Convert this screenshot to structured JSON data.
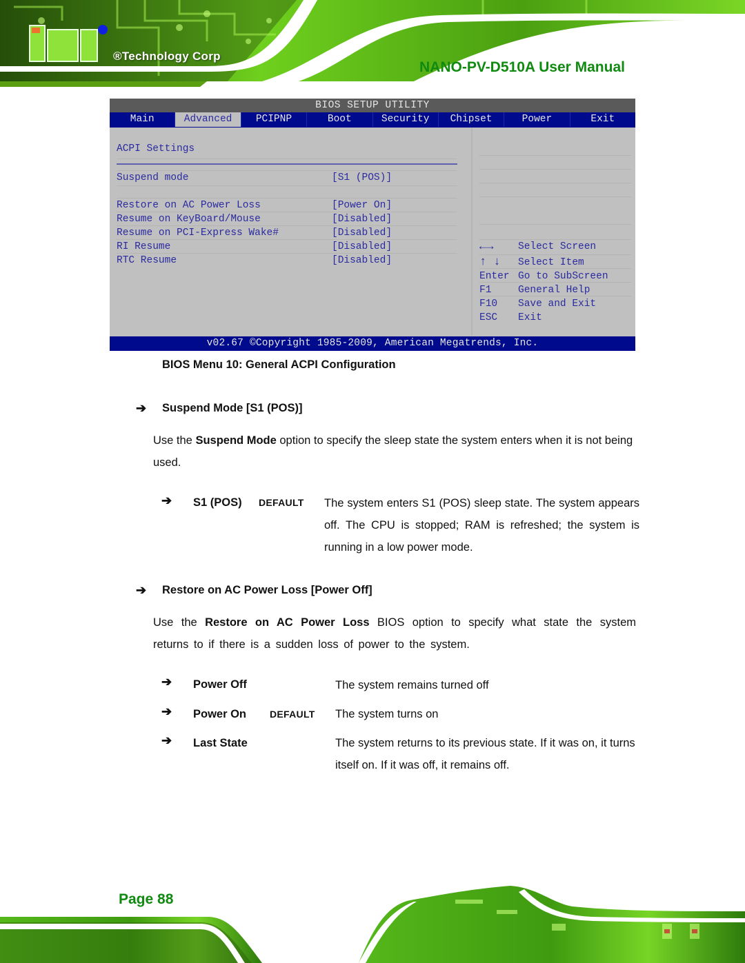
{
  "header": {
    "logo_company": "®Technology Corp",
    "document_title": "NANO-PV-D510A User Manual"
  },
  "bios": {
    "title": "BIOS SETUP UTILITY",
    "tabs": [
      {
        "label": "Main",
        "active": false
      },
      {
        "label": "Advanced",
        "active": true
      },
      {
        "label": "PCIPNP",
        "active": false
      },
      {
        "label": "Boot",
        "active": false
      },
      {
        "label": "Security",
        "active": false
      },
      {
        "label": "Chipset",
        "active": false
      },
      {
        "label": "Power",
        "active": false
      },
      {
        "label": "Exit",
        "active": false
      }
    ],
    "section_title": "ACPI Settings",
    "settings": [
      {
        "label": "Suspend mode",
        "value": "[S1 (POS)]"
      },
      {
        "label": "Restore on AC Power Loss",
        "value": "[Power On]"
      },
      {
        "label": "Resume on KeyBoard/Mouse",
        "value": "[Disabled]"
      },
      {
        "label": "Resume on PCI-Express Wake#",
        "value": "[Disabled]"
      },
      {
        "label": "RI Resume",
        "value": "[Disabled]"
      },
      {
        "label": "RTC Resume",
        "value": "[Disabled]"
      }
    ],
    "help": [
      {
        "key": "←→",
        "action": "Select Screen"
      },
      {
        "key": "↑ ↓",
        "action": "Select Item"
      },
      {
        "key": "Enter",
        "action": "Go to SubScreen"
      },
      {
        "key": "F1",
        "action": "General Help"
      },
      {
        "key": "F10",
        "action": "Save and Exit"
      },
      {
        "key": "ESC",
        "action": "Exit"
      }
    ],
    "footer": "v02.67 ©Copyright 1985-2009, American Megatrends, Inc."
  },
  "caption": "BIOS Menu 10: General ACPI Configuration",
  "sections": [
    {
      "heading": "Suspend Mode [S1 (POS)]",
      "para_prefix": "Use the ",
      "para_bold": "Suspend Mode",
      "para_suffix": " option to specify the sleep state the system enters when it is not being used.",
      "options": [
        {
          "name": "S1 (POS)",
          "default_label": "Default",
          "description": "The system enters S1 (POS) sleep state. The system appears off. The CPU is stopped; RAM is refreshed; the system is running in a low power mode."
        }
      ]
    },
    {
      "heading": "Restore on AC Power Loss [Power Off]",
      "para_prefix": "Use the ",
      "para_bold": "Restore on AC Power Loss",
      "para_suffix": " BIOS option to specify what state the system returns to if there is a sudden loss of power to the system.",
      "options": [
        {
          "name": "Power Off",
          "default_label": "",
          "description": "The system remains turned off"
        },
        {
          "name": "Power On",
          "default_label": "Default",
          "description": "The system turns on"
        },
        {
          "name": "Last State",
          "default_label": "",
          "description": "The system returns to its previous state. If it was on, it turns itself on. If it was off, it remains off."
        }
      ]
    }
  ],
  "icons": {
    "bullet": "➔"
  },
  "footer": {
    "page_label": "Page 88"
  },
  "colors": {
    "accent_green": "#118a11",
    "bios_blue": "#000a8c",
    "bios_text": "#2a2aa0",
    "bios_gray": "#c0c0c0"
  }
}
